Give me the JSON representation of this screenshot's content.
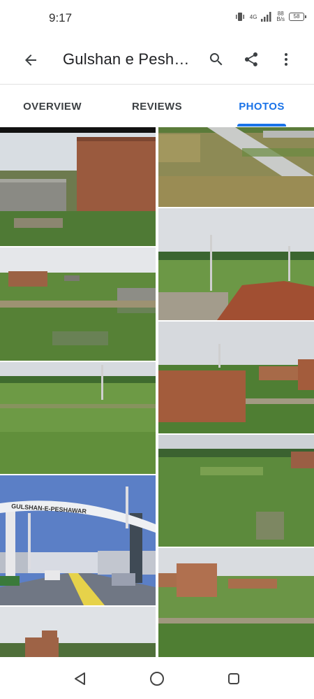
{
  "status_bar": {
    "time": "9:17",
    "network_type": "4G",
    "net_speed_value": "88",
    "net_speed_unit": "B/s",
    "battery": "58"
  },
  "app_bar": {
    "title": "Gulshan e Pesha…",
    "back_icon": "arrow-left-icon",
    "search_icon": "search-icon",
    "share_icon": "share-icon",
    "more_icon": "more-vert-icon"
  },
  "tabs": {
    "overview": "OVERVIEW",
    "reviews": "REVIEWS",
    "photos": "PHOTOS",
    "active": "PHOTOS"
  },
  "photos": {
    "gate_sign": "GULSHAN-E-PESHAWAR"
  },
  "colors": {
    "accent": "#1a73e8",
    "text": "#202124",
    "tab_text": "#3c4043"
  },
  "nav_bar": {
    "back_icon": "triangle-back-icon",
    "home_icon": "circle-home-icon",
    "recent_icon": "square-recents-icon"
  }
}
